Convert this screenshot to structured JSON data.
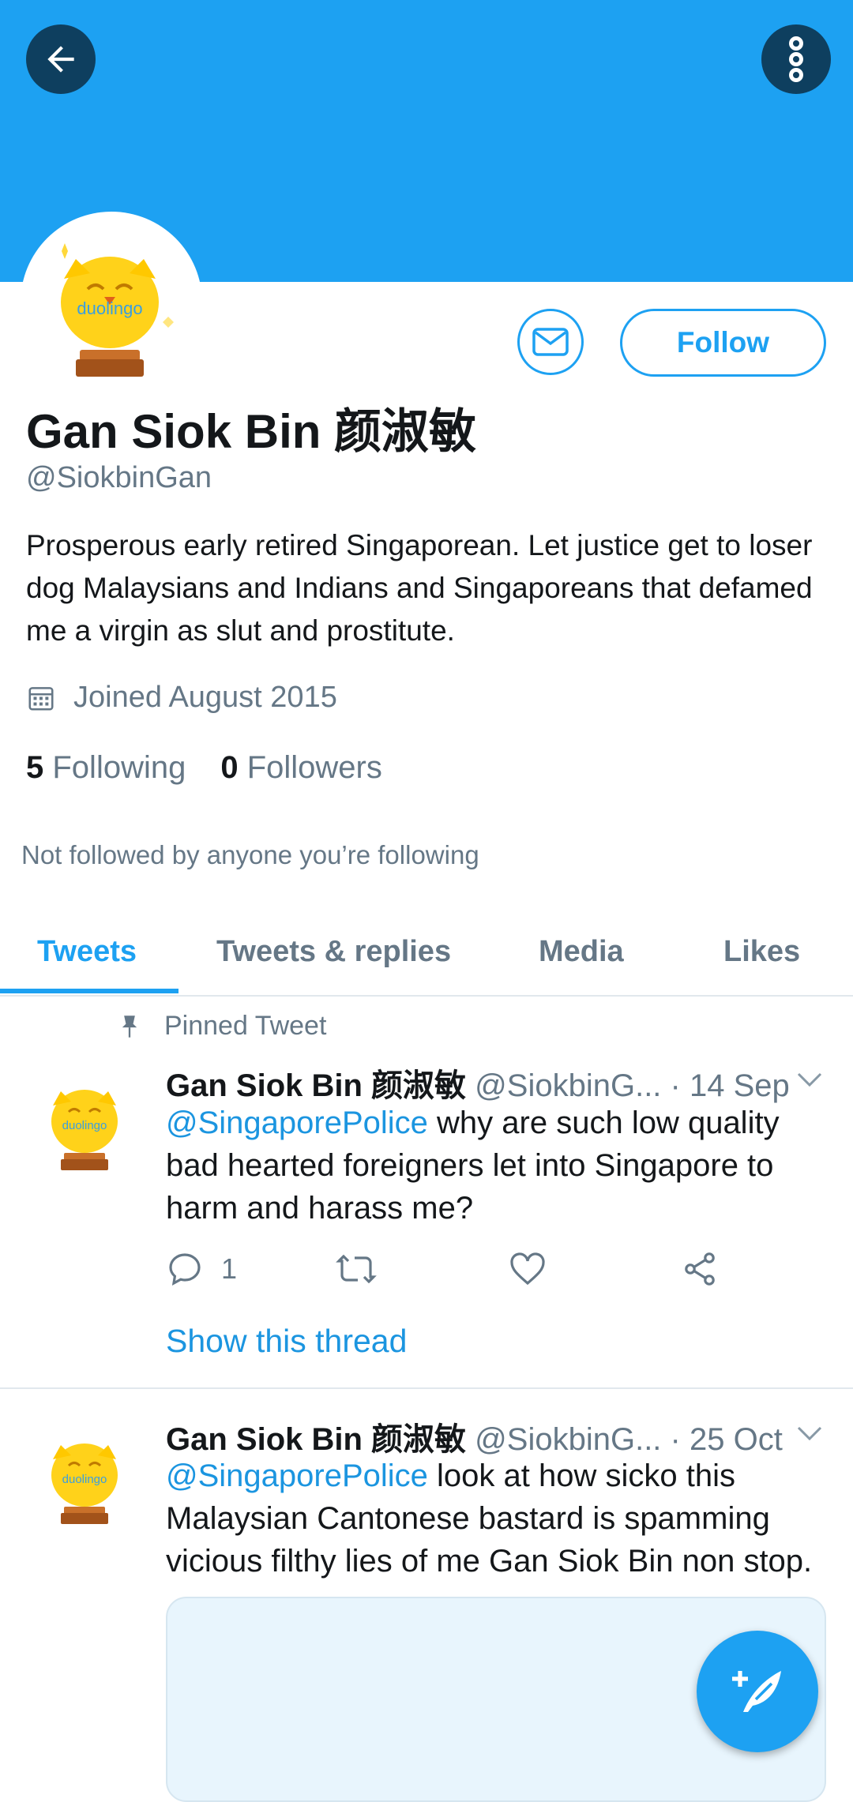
{
  "profile": {
    "name": "Gan Siok Bin 颜淑敏",
    "handle": "@SiokbinGan",
    "bio": "Prosperous early retired Singaporean. Let justice get to loser dog Malaysians and Indians and Singaporeans that defamed me a virgin as slut and prostitute.",
    "joined": "Joined August 2015",
    "following_count": "5",
    "following_label": "Following",
    "followers_count": "0",
    "followers_label": "Followers",
    "not_followed_note": "Not followed by anyone you’re following",
    "avatar_text": "duolingo"
  },
  "actions": {
    "follow_label": "Follow"
  },
  "tabs": [
    "Tweets",
    "Tweets & replies",
    "Media",
    "Likes"
  ],
  "tweets": [
    {
      "pinned_label": "Pinned Tweet",
      "name": "Gan Siok Bin 颜淑敏",
      "handle": "@SiokbinG...",
      "date": "· 14 Sep",
      "mention": "@SingaporePolice",
      "text": " why are such low quality bad hearted foreigners let into Singapore to harm and harass me?",
      "reply_count": "1",
      "thread_link": "Show this thread"
    },
    {
      "name": "Gan Siok Bin 颜淑敏",
      "handle": "@SiokbinG...",
      "date": "· 25 Oct",
      "mention": "@SingaporePolice",
      "text": " look at how sicko this Malaysian Cantonese bastard is spamming vicious filthy lies of me Gan Siok Bin non stop."
    }
  ],
  "colors": {
    "accent": "#1da1f2",
    "banner": "#1da1f2",
    "muted": "#657786",
    "link": "#1b95e0"
  },
  "icons": [
    "back-arrow-icon",
    "more-vertical-icon",
    "envelope-icon",
    "calendar-icon",
    "pin-icon",
    "reply-icon",
    "retweet-icon",
    "like-icon",
    "share-icon",
    "chevron-down-icon",
    "compose-tweet-icon"
  ]
}
